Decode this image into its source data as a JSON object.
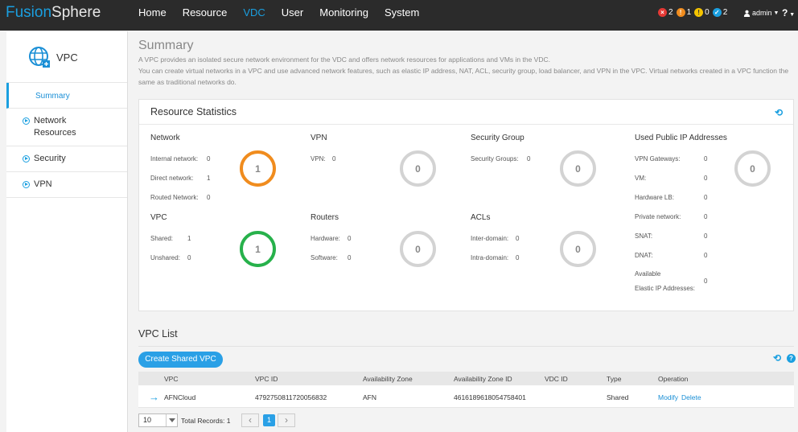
{
  "header": {
    "logo_part1": "Fusion",
    "logo_part2": "Sphere",
    "nav": [
      "Home",
      "Resource",
      "VDC",
      "User",
      "Monitoring",
      "System"
    ],
    "active_nav": "VDC",
    "alarms": [
      {
        "icon": "critical-alarm-icon",
        "symbol": "×",
        "count": "2",
        "color": "#e53935"
      },
      {
        "icon": "major-alarm-icon",
        "symbol": "!",
        "count": "1",
        "color": "#f08c1e"
      },
      {
        "icon": "minor-alarm-icon",
        "symbol": "!",
        "count": "0",
        "color": "#f5c400"
      },
      {
        "icon": "warning-alarm-icon",
        "symbol": "✓",
        "count": "2",
        "color": "#1a9fe0"
      }
    ],
    "user": "admin",
    "help": "?"
  },
  "sidebar": {
    "title": "VPC",
    "items": [
      {
        "label": "Summary",
        "active": true
      },
      {
        "label": "Network Resources"
      },
      {
        "label": "Security"
      },
      {
        "label": "VPN"
      }
    ]
  },
  "summary": {
    "title": "Summary",
    "desc1": "A VPC provides an isolated secure network environment for the VDC and offers network resources for applications and VMs in the VDC.",
    "desc2": "You can create virtual networks in a VPC and use advanced network features, such as elastic IP address, NAT, ACL, security group, load balancer, and VPN in the VPC. Virtual networks created in a VPC function the same as traditional networks do."
  },
  "resource_statistics": {
    "title": "Resource Statistics",
    "network": {
      "title": "Network",
      "lines": [
        [
          "Internal network:",
          "0"
        ],
        [
          "Direct network:",
          "1"
        ],
        [
          "Routed Network:",
          "0"
        ]
      ],
      "total": "1"
    },
    "vpn": {
      "title": "VPN",
      "lines": [
        [
          "VPN:",
          "0"
        ]
      ],
      "total": "0"
    },
    "security_group": {
      "title": "Security Group",
      "lines": [
        [
          "Security Groups:",
          "0"
        ]
      ],
      "total": "0"
    },
    "public_ip": {
      "title": "Used Public IP Addresses",
      "lines": [
        [
          "VPN Gateways:",
          "0"
        ],
        [
          "VM:",
          "0"
        ],
        [
          "Hardware LB:",
          "0"
        ],
        [
          "Private network:",
          "0"
        ],
        [
          "SNAT:",
          "0"
        ],
        [
          "DNAT:",
          "0"
        ]
      ],
      "available_label1": "Available",
      "available_label2": "Elastic IP Addresses:",
      "available_value": "0",
      "total": "0"
    },
    "vpc": {
      "title": "VPC",
      "lines": [
        [
          "Shared:",
          "1"
        ],
        [
          "Unshared:",
          "0"
        ]
      ],
      "total": "1"
    },
    "routers": {
      "title": "Routers",
      "lines": [
        [
          "Hardware:",
          "0"
        ],
        [
          "Software:",
          "0"
        ]
      ],
      "total": "0"
    },
    "acls": {
      "title": "ACLs",
      "lines": [
        [
          "Inter-domain:",
          "0"
        ],
        [
          "Intra-domain:",
          "0"
        ]
      ],
      "total": "0"
    }
  },
  "vpc_list": {
    "title": "VPC List",
    "create_button": "Create Shared VPC",
    "columns": [
      "VPC",
      "VPC ID",
      "Availability Zone",
      "Availability Zone ID",
      "VDC ID",
      "Type",
      "Operation"
    ],
    "rows": [
      {
        "vpc": "AFNCloud",
        "vpc_id": "4792750811720056832",
        "az": "AFN",
        "az_id": "4616189618054758401",
        "vdc_id": "",
        "type": "Shared",
        "modify": "Modify",
        "delete": "Delete"
      }
    ],
    "page_size": "10",
    "total_records": "Total Records: 1",
    "current_page": "1"
  }
}
